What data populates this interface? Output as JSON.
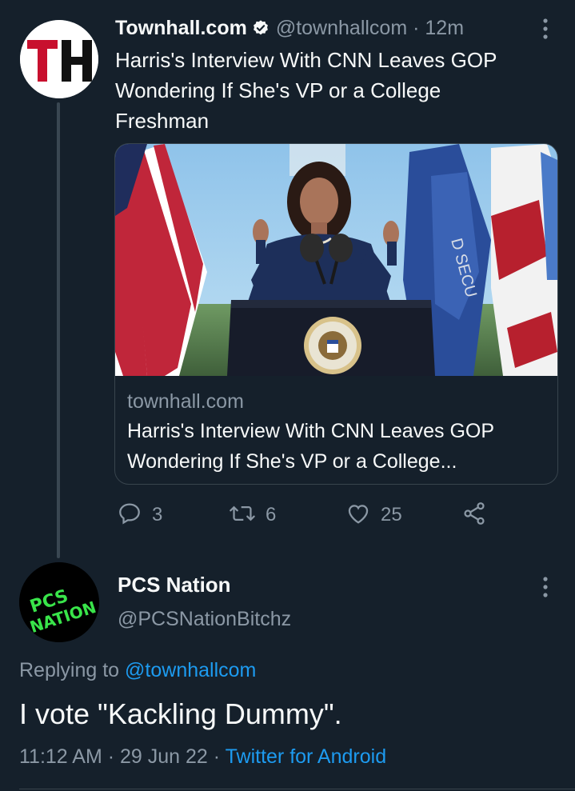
{
  "parent_tweet": {
    "display_name": "Townhall.com",
    "handle": "@townhallcom",
    "separator": "·",
    "time": "12m",
    "text": "Harris's Interview With CNN Leaves GOP Wondering If She's VP or a College Freshman",
    "avatar_text": "TH",
    "card": {
      "domain": "townhall.com",
      "title": "Harris's Interview With CNN Leaves GOP Wondering If She's VP or a College..."
    },
    "actions": {
      "replies": "3",
      "retweets": "6",
      "likes": "25"
    }
  },
  "reply_tweet": {
    "display_name": "PCS Nation",
    "handle": "@PCSNationBitchz",
    "avatar_text": "PCS NATION",
    "replying_to_label": "Replying to",
    "replying_to_handle": "@townhallcom",
    "text": "I vote \"Kackling Dummy\".",
    "time": "11:12 AM",
    "date": "29 Jun 22",
    "separator": "·",
    "client": "Twitter for Android"
  },
  "icons": {
    "verified": "verified-badge-icon",
    "more": "more-vertical-icon",
    "reply": "reply-icon",
    "retweet": "retweet-icon",
    "like": "heart-icon",
    "share": "share-icon"
  },
  "colors": {
    "background": "#15202b",
    "text_primary": "#f7f9f9",
    "text_secondary": "#8b98a5",
    "accent": "#1d9bf0",
    "border": "#38444d",
    "th_red": "#c8102e"
  }
}
